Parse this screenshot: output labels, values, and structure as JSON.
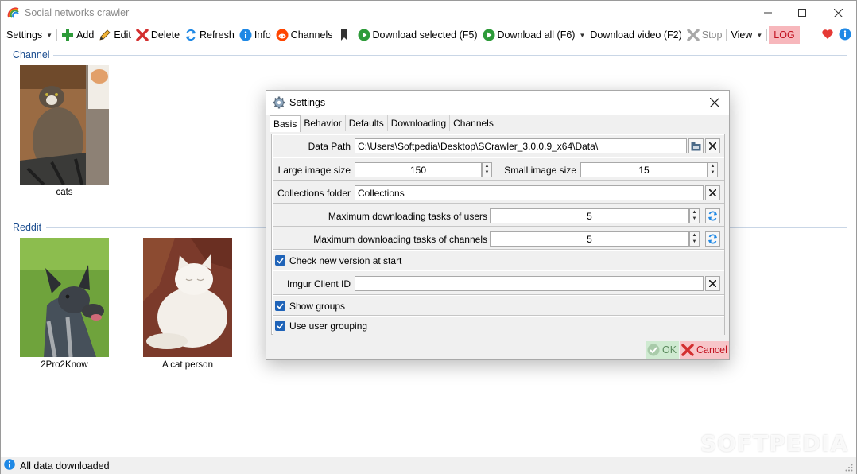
{
  "window": {
    "title": "Social networks crawler"
  },
  "toolbar": {
    "settings": "Settings",
    "add": "Add",
    "edit": "Edit",
    "delete": "Delete",
    "refresh": "Refresh",
    "info": "Info",
    "channels": "Channels",
    "download_selected": "Download selected (F5)",
    "download_all": "Download all (F6)",
    "download_video": "Download video (F2)",
    "stop": "Stop",
    "view": "View",
    "log": "LOG"
  },
  "groups": [
    {
      "title": "Channel",
      "items": [
        {
          "label": "cats"
        }
      ]
    },
    {
      "title": "Reddit",
      "items": [
        {
          "label": "2Pro2Know"
        },
        {
          "label": "A cat person"
        }
      ]
    }
  ],
  "dialog": {
    "title": "Settings",
    "tabs": [
      "Basis",
      "Behavior",
      "Defaults",
      "Downloading",
      "Channels"
    ],
    "fields": {
      "data_path": {
        "label": "Data Path",
        "value": "C:\\Users\\Softpedia\\Desktop\\SCrawler_3.0.0.9_x64\\Data\\"
      },
      "large_image_size": {
        "label": "Large image size",
        "value": "150"
      },
      "small_image_size": {
        "label": "Small image size",
        "value": "15"
      },
      "collections_folder": {
        "label": "Collections folder",
        "value": "Collections"
      },
      "max_tasks_users": {
        "label": "Maximum downloading tasks of users",
        "value": "5"
      },
      "max_tasks_channels": {
        "label": "Maximum downloading tasks of channels",
        "value": "5"
      },
      "check_new_version": {
        "label": "Check new version at start",
        "checked": true
      },
      "imgur_client_id": {
        "label": "Imgur Client ID",
        "value": ""
      },
      "show_groups": {
        "label": "Show groups",
        "checked": true
      },
      "use_user_grouping": {
        "label": "Use user grouping",
        "checked": true
      }
    },
    "ok": "OK",
    "cancel": "Cancel"
  },
  "status": {
    "text": "All data downloaded"
  },
  "watermark": "SOFTPEDIA",
  "colors": {
    "accent": "#1f63b8",
    "group_title": "#1d4f91",
    "log_bg": "#f7b7bc",
    "ok_bg": "#cfead1",
    "cancel_bg": "#f7c5c8"
  }
}
